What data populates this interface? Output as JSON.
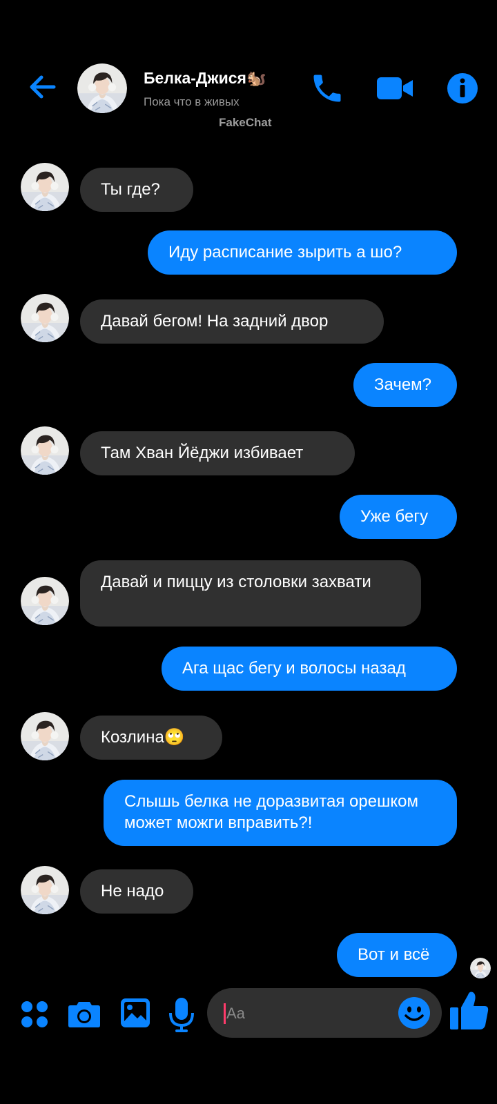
{
  "header": {
    "contact_name": "Белка-Джися🐿️",
    "status": "Пока что в живых",
    "watermark": "FakeChat"
  },
  "messages": [
    {
      "from": "contact",
      "text": "Ты где?"
    },
    {
      "from": "me",
      "text": "Иду расписание зырить а шо?"
    },
    {
      "from": "contact",
      "text": "Давай бегом! На задний двор"
    },
    {
      "from": "me",
      "text": "Зачем?"
    },
    {
      "from": "contact",
      "text": "Там Хван Йёджи избивает"
    },
    {
      "from": "me",
      "text": "Уже бегу"
    },
    {
      "from": "contact",
      "text": "Давай и пиццу из столовки захвати"
    },
    {
      "from": "me",
      "text": "Ага щас бегу и волосы назад"
    },
    {
      "from": "contact",
      "text": "Козлина🙄"
    },
    {
      "from": "me",
      "text": "Слышь белка не доразвитая орешком может можги вправить?!"
    },
    {
      "from": "contact",
      "text": "Не надо"
    },
    {
      "from": "me",
      "text": "Вот и всё"
    }
  ],
  "composer": {
    "placeholder": "Aa"
  },
  "colors": {
    "background": "#000000",
    "accent": "#0a84ff",
    "incoming_bubble": "#303030",
    "outgoing_bubble": "#0a84ff",
    "secondary_text": "#9a9a9a"
  },
  "icons": [
    "back-arrow-icon",
    "phone-icon",
    "video-camera-icon",
    "info-icon",
    "apps-grid-icon",
    "camera-icon",
    "gallery-icon",
    "microphone-icon",
    "emoji-icon",
    "thumbs-up-icon"
  ]
}
